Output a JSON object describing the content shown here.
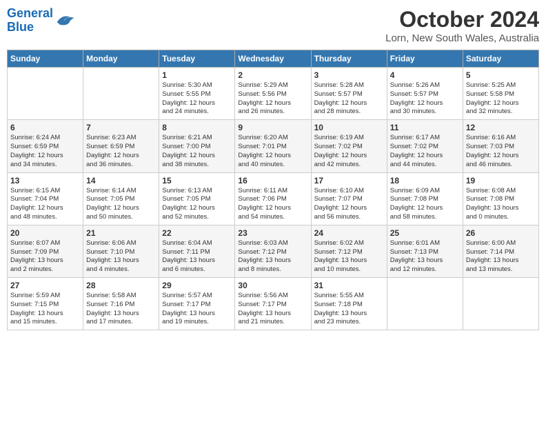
{
  "logo": {
    "line1": "General",
    "line2": "Blue"
  },
  "title": "October 2024",
  "location": "Lorn, New South Wales, Australia",
  "days_of_week": [
    "Sunday",
    "Monday",
    "Tuesday",
    "Wednesday",
    "Thursday",
    "Friday",
    "Saturday"
  ],
  "weeks": [
    [
      {
        "day": "",
        "content": ""
      },
      {
        "day": "",
        "content": ""
      },
      {
        "day": "1",
        "content": "Sunrise: 5:30 AM\nSunset: 5:55 PM\nDaylight: 12 hours\nand 24 minutes."
      },
      {
        "day": "2",
        "content": "Sunrise: 5:29 AM\nSunset: 5:56 PM\nDaylight: 12 hours\nand 26 minutes."
      },
      {
        "day": "3",
        "content": "Sunrise: 5:28 AM\nSunset: 5:57 PM\nDaylight: 12 hours\nand 28 minutes."
      },
      {
        "day": "4",
        "content": "Sunrise: 5:26 AM\nSunset: 5:57 PM\nDaylight: 12 hours\nand 30 minutes."
      },
      {
        "day": "5",
        "content": "Sunrise: 5:25 AM\nSunset: 5:58 PM\nDaylight: 12 hours\nand 32 minutes."
      }
    ],
    [
      {
        "day": "6",
        "content": "Sunrise: 6:24 AM\nSunset: 6:59 PM\nDaylight: 12 hours\nand 34 minutes."
      },
      {
        "day": "7",
        "content": "Sunrise: 6:23 AM\nSunset: 6:59 PM\nDaylight: 12 hours\nand 36 minutes."
      },
      {
        "day": "8",
        "content": "Sunrise: 6:21 AM\nSunset: 7:00 PM\nDaylight: 12 hours\nand 38 minutes."
      },
      {
        "day": "9",
        "content": "Sunrise: 6:20 AM\nSunset: 7:01 PM\nDaylight: 12 hours\nand 40 minutes."
      },
      {
        "day": "10",
        "content": "Sunrise: 6:19 AM\nSunset: 7:02 PM\nDaylight: 12 hours\nand 42 minutes."
      },
      {
        "day": "11",
        "content": "Sunrise: 6:17 AM\nSunset: 7:02 PM\nDaylight: 12 hours\nand 44 minutes."
      },
      {
        "day": "12",
        "content": "Sunrise: 6:16 AM\nSunset: 7:03 PM\nDaylight: 12 hours\nand 46 minutes."
      }
    ],
    [
      {
        "day": "13",
        "content": "Sunrise: 6:15 AM\nSunset: 7:04 PM\nDaylight: 12 hours\nand 48 minutes."
      },
      {
        "day": "14",
        "content": "Sunrise: 6:14 AM\nSunset: 7:05 PM\nDaylight: 12 hours\nand 50 minutes."
      },
      {
        "day": "15",
        "content": "Sunrise: 6:13 AM\nSunset: 7:05 PM\nDaylight: 12 hours\nand 52 minutes."
      },
      {
        "day": "16",
        "content": "Sunrise: 6:11 AM\nSunset: 7:06 PM\nDaylight: 12 hours\nand 54 minutes."
      },
      {
        "day": "17",
        "content": "Sunrise: 6:10 AM\nSunset: 7:07 PM\nDaylight: 12 hours\nand 56 minutes."
      },
      {
        "day": "18",
        "content": "Sunrise: 6:09 AM\nSunset: 7:08 PM\nDaylight: 12 hours\nand 58 minutes."
      },
      {
        "day": "19",
        "content": "Sunrise: 6:08 AM\nSunset: 7:08 PM\nDaylight: 13 hours\nand 0 minutes."
      }
    ],
    [
      {
        "day": "20",
        "content": "Sunrise: 6:07 AM\nSunset: 7:09 PM\nDaylight: 13 hours\nand 2 minutes."
      },
      {
        "day": "21",
        "content": "Sunrise: 6:06 AM\nSunset: 7:10 PM\nDaylight: 13 hours\nand 4 minutes."
      },
      {
        "day": "22",
        "content": "Sunrise: 6:04 AM\nSunset: 7:11 PM\nDaylight: 13 hours\nand 6 minutes."
      },
      {
        "day": "23",
        "content": "Sunrise: 6:03 AM\nSunset: 7:12 PM\nDaylight: 13 hours\nand 8 minutes."
      },
      {
        "day": "24",
        "content": "Sunrise: 6:02 AM\nSunset: 7:12 PM\nDaylight: 13 hours\nand 10 minutes."
      },
      {
        "day": "25",
        "content": "Sunrise: 6:01 AM\nSunset: 7:13 PM\nDaylight: 13 hours\nand 12 minutes."
      },
      {
        "day": "26",
        "content": "Sunrise: 6:00 AM\nSunset: 7:14 PM\nDaylight: 13 hours\nand 13 minutes."
      }
    ],
    [
      {
        "day": "27",
        "content": "Sunrise: 5:59 AM\nSunset: 7:15 PM\nDaylight: 13 hours\nand 15 minutes."
      },
      {
        "day": "28",
        "content": "Sunrise: 5:58 AM\nSunset: 7:16 PM\nDaylight: 13 hours\nand 17 minutes."
      },
      {
        "day": "29",
        "content": "Sunrise: 5:57 AM\nSunset: 7:17 PM\nDaylight: 13 hours\nand 19 minutes."
      },
      {
        "day": "30",
        "content": "Sunrise: 5:56 AM\nSunset: 7:17 PM\nDaylight: 13 hours\nand 21 minutes."
      },
      {
        "day": "31",
        "content": "Sunrise: 5:55 AM\nSunset: 7:18 PM\nDaylight: 13 hours\nand 23 minutes."
      },
      {
        "day": "",
        "content": ""
      },
      {
        "day": "",
        "content": ""
      }
    ]
  ]
}
